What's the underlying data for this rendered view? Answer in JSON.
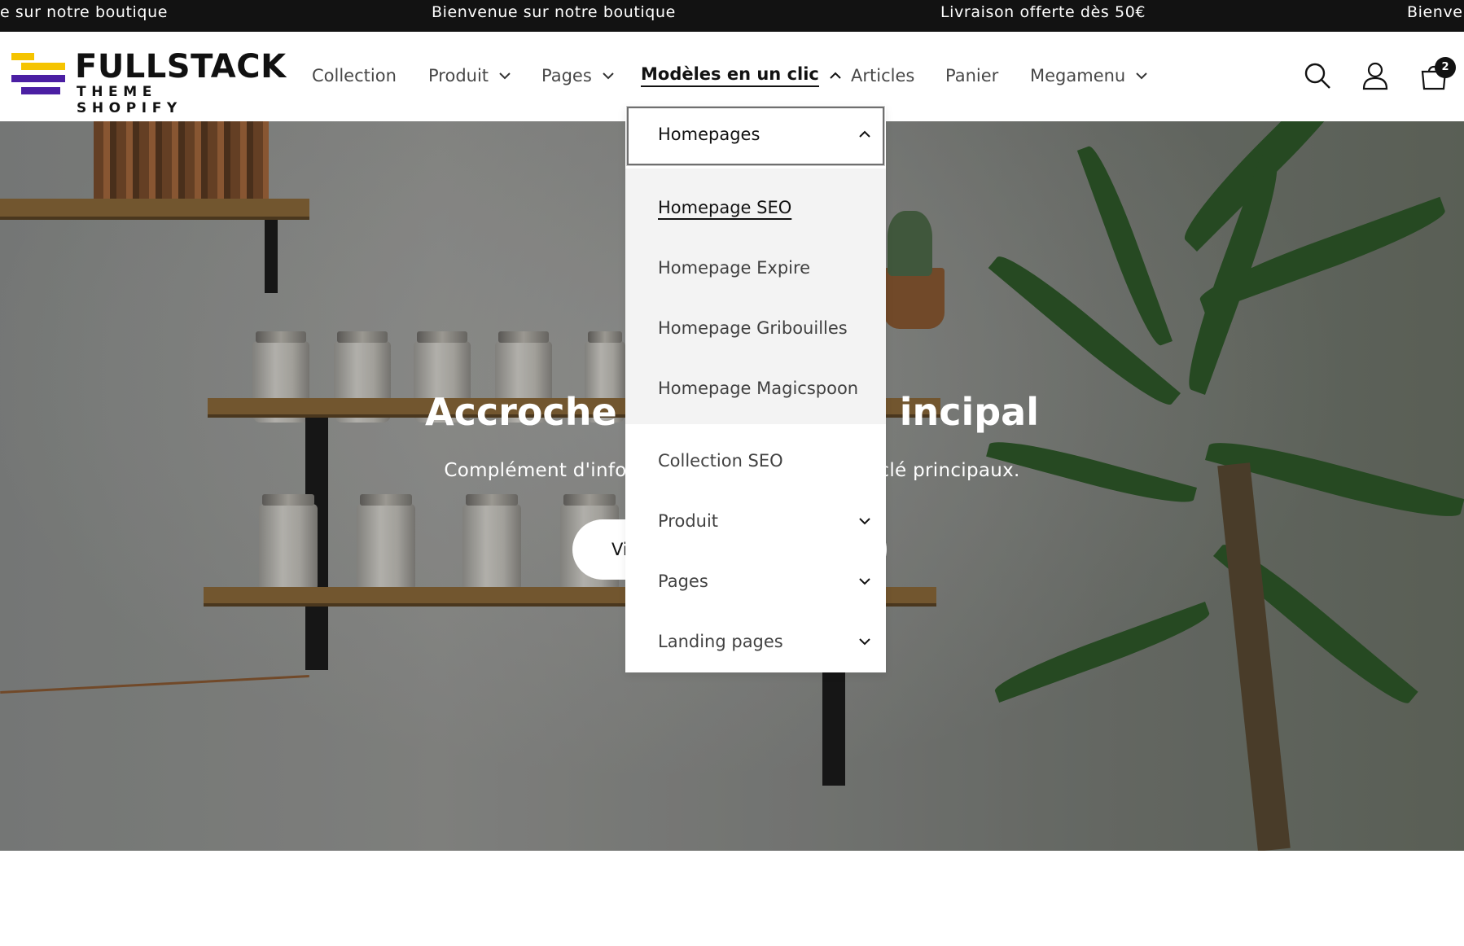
{
  "announcement_bar": {
    "messages": [
      "e sur notre boutique",
      "Bienvenue sur notre boutique",
      "Livraison offerte dès 50€",
      "Bienve"
    ]
  },
  "header": {
    "logo": {
      "main_text": "FULLSTACK",
      "sub_text": "THEME SHOPIFY",
      "colors": {
        "yellow": "#f5c400",
        "purple": "#4b1fa3"
      }
    },
    "nav": [
      {
        "label": "Collection",
        "has_dropdown": false
      },
      {
        "label": "Produit",
        "has_dropdown": true
      },
      {
        "label": "Pages",
        "has_dropdown": true
      },
      {
        "label": "Modèles en un clic",
        "has_dropdown": true,
        "active": true
      },
      {
        "label": "Articles",
        "has_dropdown": false
      },
      {
        "label": "Panier",
        "has_dropdown": false
      },
      {
        "label": "Megamenu",
        "has_dropdown": true
      }
    ],
    "icons": [
      "search-icon",
      "account-icon",
      "cart-icon"
    ],
    "cart_count": "2"
  },
  "dropdown": {
    "open_group": "Homepages",
    "open_items": [
      "Homepage SEO",
      "Homepage Expire",
      "Homepage Gribouilles",
      "Homepage Magicspoon"
    ],
    "current_item": "Homepage SEO",
    "other_items": [
      {
        "label": "Collection SEO",
        "has_children": false
      },
      {
        "label": "Produit",
        "has_children": true
      },
      {
        "label": "Pages",
        "has_children": true
      },
      {
        "label": "Landing pages",
        "has_children": true
      }
    ]
  },
  "hero": {
    "title_left": "Accroche a",
    "title_right": "incipal",
    "subtitle_left": "Complément d'infor",
    "subtitle_right": "clé principaux.",
    "button_label": "Vi"
  }
}
